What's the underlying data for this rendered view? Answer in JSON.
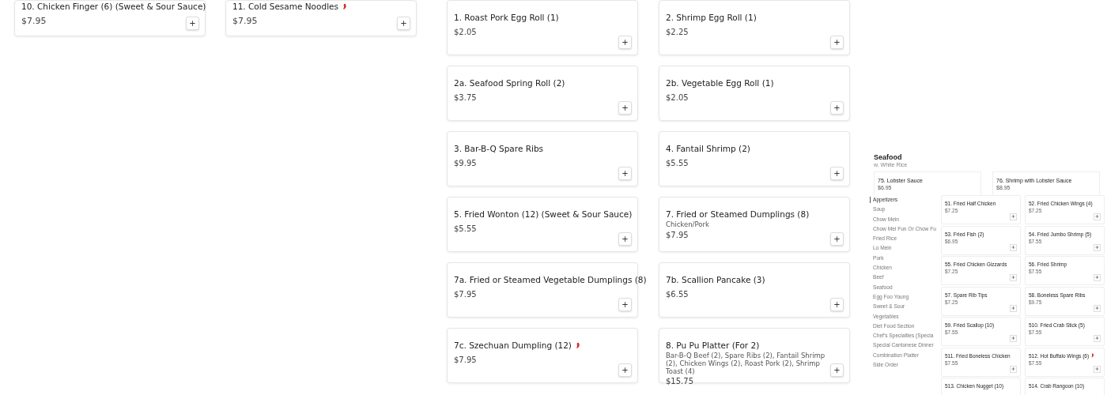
{
  "left_cards": [
    {
      "title": "10. Chicken Finger (6) (Sweet & Sour Sauce)",
      "spicy": false,
      "price": "$7.95",
      "add": "+"
    },
    {
      "title": "11. Cold Sesame Noodles",
      "spicy": true,
      "price": "$7.95",
      "add": "+"
    }
  ],
  "menu_cards": [
    {
      "title": "1. Roast Pork Egg Roll (1)",
      "spicy": false,
      "price": "$2.05",
      "add": "+"
    },
    {
      "title": "2. Shrimp Egg Roll (1)",
      "spicy": false,
      "price": "$2.25",
      "add": "+"
    },
    {
      "title": "2a. Seafood Spring Roll (2)",
      "spicy": false,
      "price": "$3.75",
      "add": "+"
    },
    {
      "title": "2b. Vegetable Egg Roll (1)",
      "spicy": false,
      "price": "$2.05",
      "add": "+"
    },
    {
      "title": "3. Bar-B-Q Spare Ribs",
      "spicy": false,
      "price": "$9.95",
      "add": "+"
    },
    {
      "title": "4. Fantail Shrimp (2)",
      "spicy": false,
      "price": "$5.55",
      "add": "+"
    },
    {
      "title": "5. Fried Wonton (12) (Sweet & Sour Sauce)",
      "spicy": false,
      "price": "$5.55",
      "add": "+"
    },
    {
      "title": "7. Fried or Steamed Dumplings (8)",
      "spicy": false,
      "description": "Chicken/Pork",
      "price": "$7.95",
      "add": "+"
    },
    {
      "title": "7a. Fried or Steamed Vegetable Dumplings (8)",
      "spicy": false,
      "price": "$7.95",
      "add": "+"
    },
    {
      "title": "7b. Scallion Pancake (3)",
      "spicy": false,
      "price": "$6.55",
      "add": "+"
    },
    {
      "title": "7c. Szechuan Dumpling (12)",
      "spicy": true,
      "price": "$7.95",
      "add": "+"
    },
    {
      "title": "8. Pu Pu Platter (For 2)",
      "spicy": false,
      "description": "Bar-B-Q Beef (2), Spare Ribs (2), Fantail Shrimp (2), Chicken Wings (2), Roast Pork (2), Shrimp Toast (4)",
      "price": "$15.75",
      "add": "+"
    }
  ],
  "mini_page": {
    "heading": "Seafood",
    "subheading": "w. White Rice",
    "top_cards": [
      {
        "title": "75. Lobster Sauce",
        "price": "$6.95"
      },
      {
        "title": "76. Shrimp with Lobster Sauce",
        "price": "$8.95"
      }
    ],
    "categories": [
      {
        "label": "Appetizers",
        "selected": true
      },
      {
        "label": "Soup",
        "selected": false
      },
      {
        "label": "Chow Mein",
        "selected": false
      },
      {
        "label": "Chow Mei Fun Or Chow Fu",
        "selected": false
      },
      {
        "label": "Fried Rice",
        "selected": false
      },
      {
        "label": "Lo Mein",
        "selected": false
      },
      {
        "label": "Pork",
        "selected": false
      },
      {
        "label": "Chicken",
        "selected": false
      },
      {
        "label": "Beef",
        "selected": false
      },
      {
        "label": "Seafood",
        "selected": false
      },
      {
        "label": "Egg Foo Young",
        "selected": false
      },
      {
        "label": "Sweet & Sour",
        "selected": false
      },
      {
        "label": "Vegetables",
        "selected": false
      },
      {
        "label": "Diet Food Section",
        "selected": false
      },
      {
        "label": "Chef's Specialties (Specia",
        "selected": false
      },
      {
        "label": "Special Cantonese Dinner",
        "selected": false
      },
      {
        "label": "Combination Platter",
        "selected": false
      },
      {
        "label": "Side Order",
        "selected": false
      }
    ],
    "items": [
      {
        "title": "51. Fried Half Chicken",
        "spicy": false,
        "price": "$7.25",
        "add": "+"
      },
      {
        "title": "52. Fried Chicken Wings (4)",
        "spicy": false,
        "price": "$7.25",
        "add": "+"
      },
      {
        "title": "53. Fried Fish (2)",
        "spicy": false,
        "price": "$6.95",
        "add": "+"
      },
      {
        "title": "54. Fried Jumbo Shrimp (5)",
        "spicy": false,
        "price": "$7.55",
        "add": "+"
      },
      {
        "title": "55. Fried Chicken Gizzards",
        "spicy": false,
        "price": "$7.25",
        "add": "+"
      },
      {
        "title": "56. Fried Shrimp",
        "spicy": false,
        "price": "$7.55",
        "add": "+"
      },
      {
        "title": "57. Spare Rib Tips",
        "spicy": false,
        "price": "$7.25",
        "add": "+"
      },
      {
        "title": "58. Boneless Spare Ribs",
        "spicy": false,
        "price": "$9.75",
        "add": "+"
      },
      {
        "title": "59. Fried Scallop (10)",
        "spicy": false,
        "price": "$7.55",
        "add": "+"
      },
      {
        "title": "510. Fried Crab Stick (5)",
        "spicy": false,
        "price": "$7.55",
        "add": "+"
      },
      {
        "title": "511. Fried Boneless Chicken",
        "spicy": false,
        "price": "$7.55",
        "add": "+"
      },
      {
        "title": "512. Hot Buffalo Wings (6)",
        "spicy": true,
        "price": "$7.55",
        "add": "+"
      },
      {
        "title": "513. Chicken Nugget (10)",
        "spicy": false
      },
      {
        "title": "514. Crab Rangoon (10)",
        "spicy": false
      }
    ]
  }
}
